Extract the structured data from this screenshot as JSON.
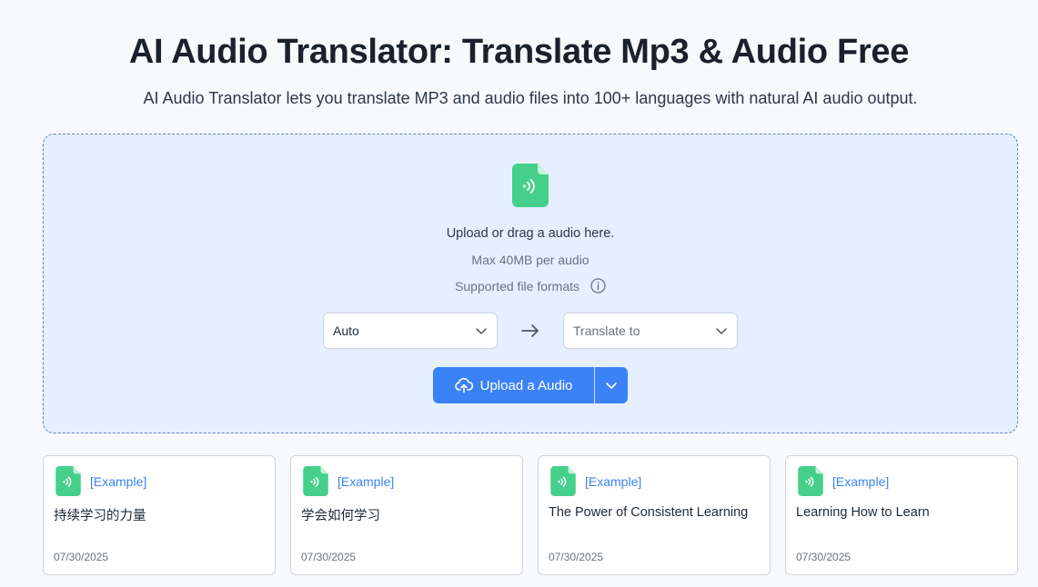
{
  "header": {
    "title": "AI Audio Translator: Translate Mp3 & Audio Free",
    "subtitle": "AI Audio Translator lets you translate MP3 and audio files into 100+ languages with natural AI audio output."
  },
  "dropzone": {
    "icon": "audio-file-icon",
    "upload_text": "Upload or drag a audio here.",
    "max_size": "Max 40MB per audio",
    "formats_label": "Supported file formats",
    "source_language": "Auto",
    "target_placeholder": "Translate to",
    "upload_button": "Upload a Audio"
  },
  "colors": {
    "accent": "#3b82f6",
    "file_icon": "#44cf8a",
    "dropzone_bg": "#e5efff"
  },
  "examples": [
    {
      "tag": "[Example]",
      "title": "持续学习的力量",
      "date": "07/30/2025"
    },
    {
      "tag": "[Example]",
      "title": "学会如何学习",
      "date": "07/30/2025"
    },
    {
      "tag": "[Example]",
      "title": "The Power of Consistent Learning",
      "date": "07/30/2025"
    },
    {
      "tag": "[Example]",
      "title": "Learning How to Learn",
      "date": "07/30/2025"
    }
  ]
}
